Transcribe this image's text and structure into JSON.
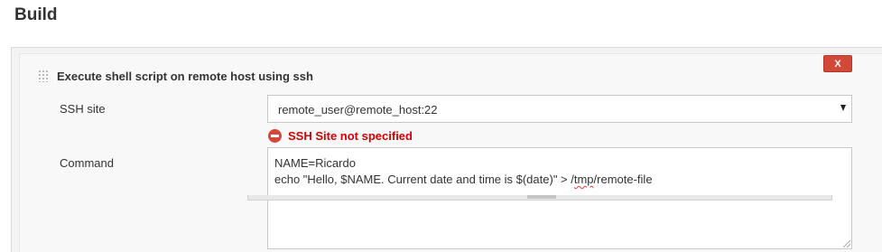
{
  "section": {
    "title": "Build"
  },
  "build_step": {
    "title": "Execute shell script on remote host using ssh",
    "delete_label": "X",
    "delete_color": "#d24939",
    "ssh_site": {
      "label": "SSH site",
      "selected_value": "remote_user@remote_host:22",
      "error": "SSH Site not specified",
      "error_icon": "minus-circle-icon"
    },
    "command": {
      "label": "Command",
      "lines": [
        "NAME=Ricardo",
        "echo \"Hello, $NAME. Current date and time is $(date)\" > /tmp/remote-file"
      ],
      "line2_parts": {
        "before": "echo \"Hello, $NAME. Current date and time is $(date)\" > /",
        "underlined": "tmp",
        "after": "/remote-file"
      }
    }
  }
}
